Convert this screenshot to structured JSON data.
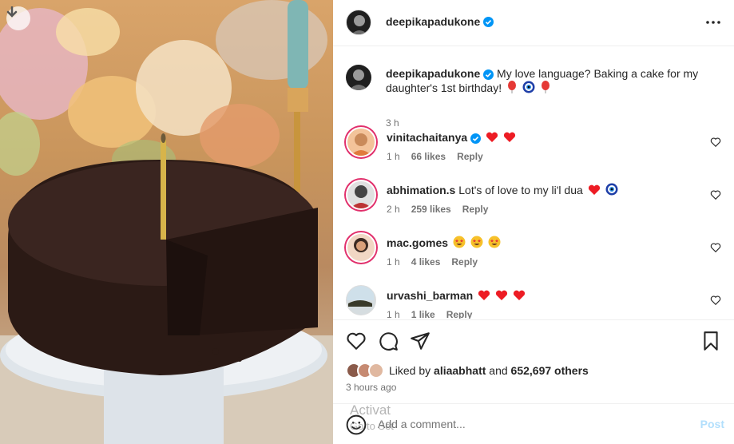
{
  "post": {
    "author": "deepikapadukone",
    "caption_text": "My love language? Baking a cake for my daughter's 1st birthday!",
    "caption_time": "3 h"
  },
  "comments": [
    {
      "user": "vinitachaitanya",
      "text": "",
      "time": "1 h",
      "likes": "66 likes",
      "reply": "Reply",
      "emoji": [
        "heart",
        "heart"
      ]
    },
    {
      "user": "abhimation.s",
      "text": "Lot's of love to my li'l dua",
      "time": "2 h",
      "likes": "259 likes",
      "reply": "Reply",
      "emoji": [
        "heart",
        "evil-eye"
      ]
    },
    {
      "user": "mac.gomes",
      "text": "",
      "time": "1 h",
      "likes": "4 likes",
      "reply": "Reply",
      "emoji": [
        "star-eyes",
        "star-eyes",
        "star-eyes"
      ]
    },
    {
      "user": "urvashi_barman",
      "text": "",
      "time": "1 h",
      "likes": "1 like",
      "reply": "Reply",
      "emoji": [
        "heart",
        "heart",
        "heart"
      ]
    }
  ],
  "likes": {
    "prefix": "Liked by",
    "user": "aliaabhatt",
    "middle": "and",
    "others": "652,697 others"
  },
  "time_ago": "3 hours ago",
  "add_comment": {
    "placeholder": "Add a comment...",
    "post_label": "Post"
  },
  "watermark": {
    "line1": "Activat",
    "line2": "Go to Set"
  },
  "colors": {
    "verified": "#0095f6",
    "heart": "#ed1c24",
    "post_disabled": "#b2dffc"
  },
  "icons": {
    "like": "heart-outline-icon",
    "comment": "comment-bubble-icon",
    "share": "paper-plane-icon",
    "save": "bookmark-icon",
    "more": "more-options-icon",
    "download": "download-arrow-icon",
    "emoji": "smiley-icon"
  }
}
